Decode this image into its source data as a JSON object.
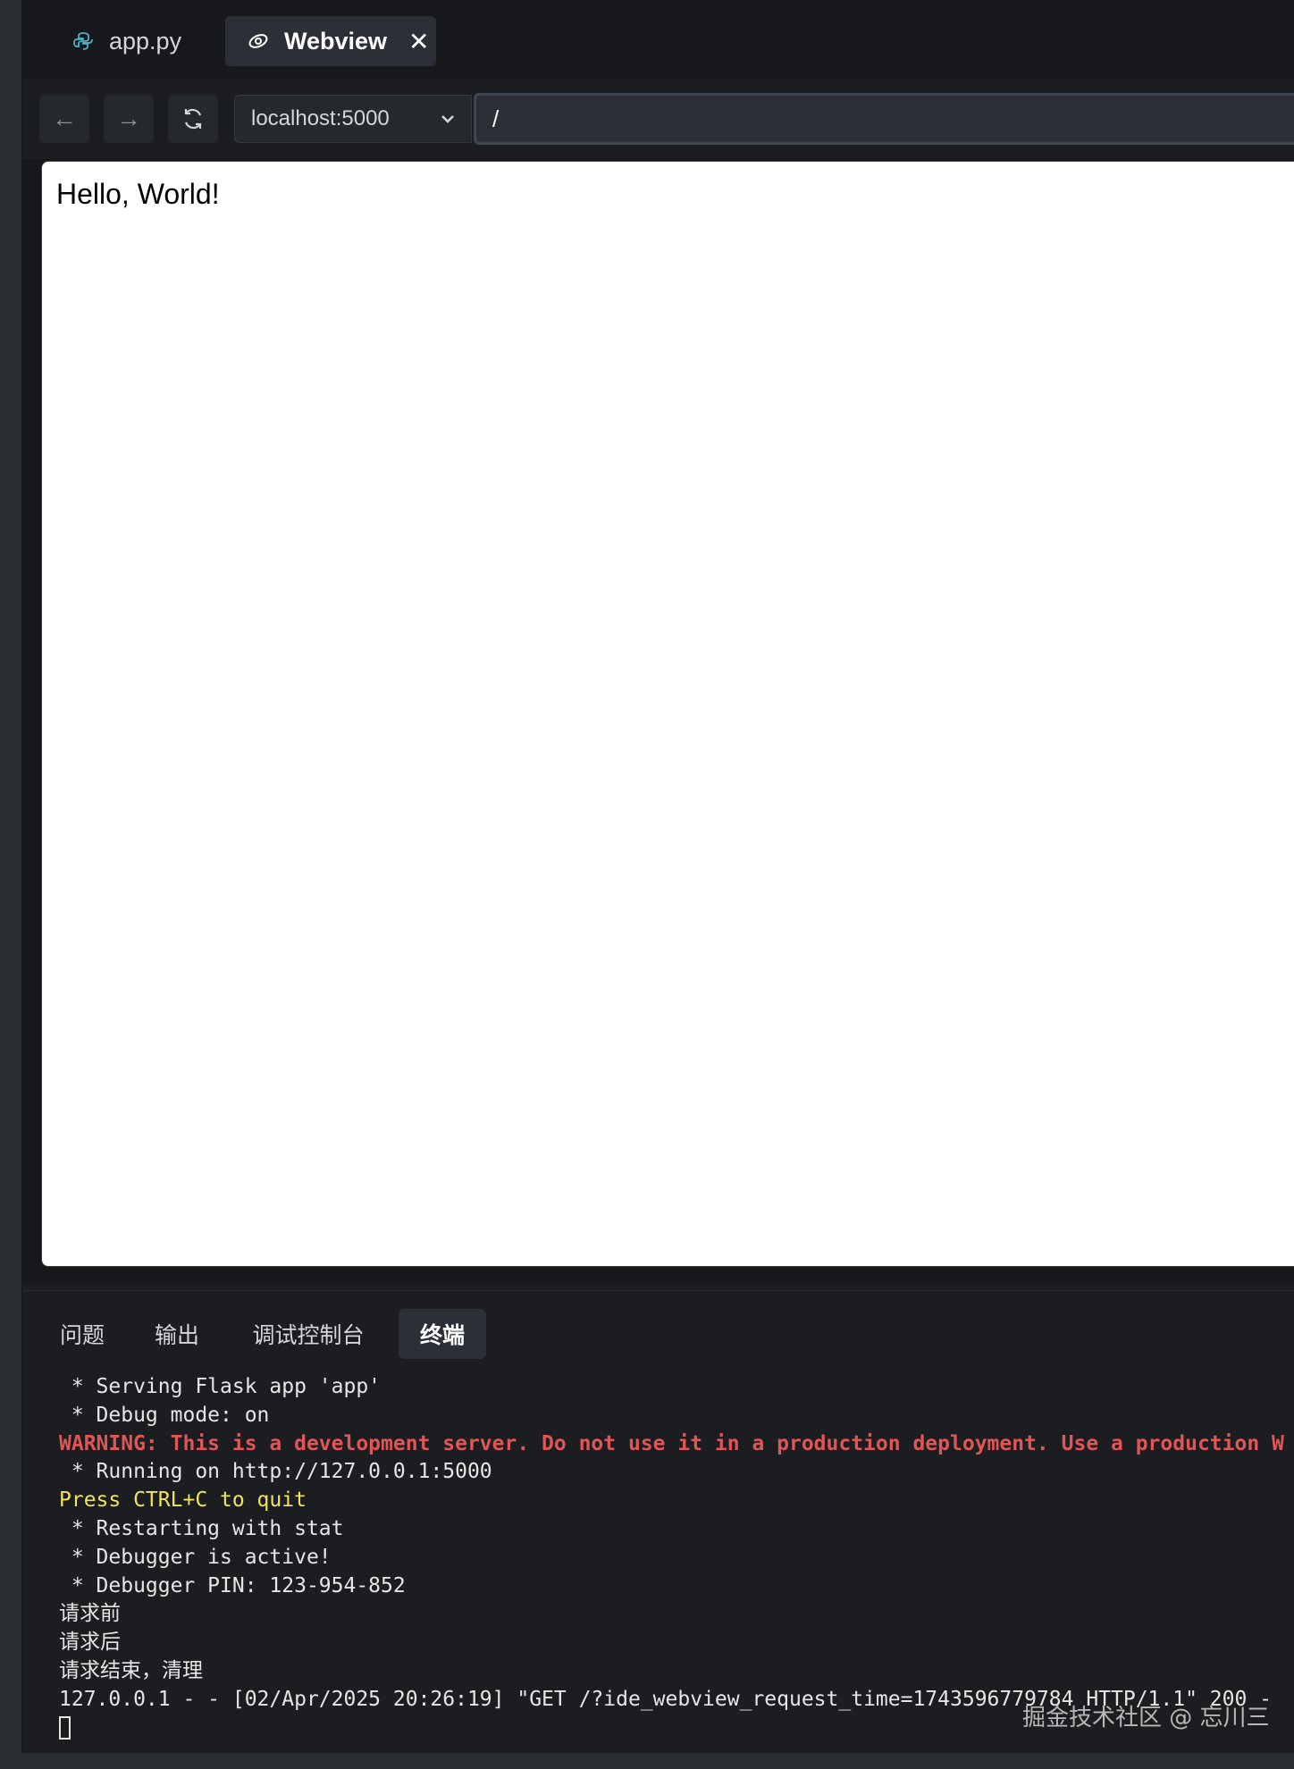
{
  "editor": {
    "tabs": [
      {
        "label": "app.py",
        "icon": "python-icon",
        "active": false
      },
      {
        "label": "Webview",
        "icon": "webview-icon",
        "active": true,
        "close": "✕"
      }
    ]
  },
  "navbar": {
    "back_icon": "←",
    "forward_icon": "→",
    "reload_icon": "reload-icon",
    "host": "localhost:5000",
    "path": "/"
  },
  "webview": {
    "content": "Hello, World!"
  },
  "panel": {
    "tabs": [
      "问题",
      "输出",
      "调试控制台",
      "终端"
    ],
    "active_tab": "终端",
    "terminal_lines": [
      {
        "text": " * Serving Flask app 'app'",
        "style": "normal"
      },
      {
        "text": " * Debug mode: on",
        "style": "normal"
      },
      {
        "text": "WARNING: This is a development server. Do not use it in a production deployment. Use a production W",
        "style": "warn"
      },
      {
        "text": " * Running on http://127.0.0.1:5000",
        "style": "normal"
      },
      {
        "text": "Press CTRL+C to quit",
        "style": "yellow"
      },
      {
        "text": " * Restarting with stat",
        "style": "normal"
      },
      {
        "text": " * Debugger is active!",
        "style": "normal"
      },
      {
        "text": " * Debugger PIN: 123-954-852",
        "style": "normal"
      },
      {
        "text": "请求前",
        "style": "normal"
      },
      {
        "text": "请求后",
        "style": "normal"
      },
      {
        "text": "请求结束，清理",
        "style": "normal"
      },
      {
        "text": "127.0.0.1 - - [02/Apr/2025 20:26:19] \"GET /?ide_webview_request_time=1743596779784 HTTP/1.1\" 200 -",
        "style": "normal"
      }
    ]
  },
  "watermark": "掘金技术社区 @ 忘川三",
  "colors": {
    "background": "#1b1d21",
    "warning": "#e05555",
    "highlight": "#f1e35a",
    "python_icon": "#4fb3c8"
  }
}
